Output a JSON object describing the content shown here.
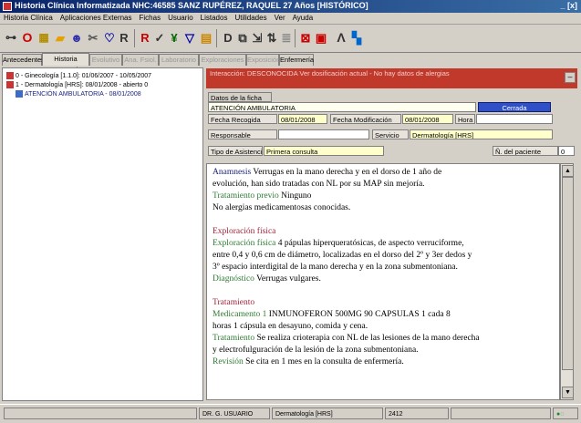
{
  "window": {
    "title": "Historia Clínica Informatizada  NHC:46585   SANZ RUPÉREZ, RAQUEL   27 Años [HISTÓRICO]",
    "controls": "_ [x]"
  },
  "menu": [
    "Historia Clínica",
    "Aplicaciones Externas",
    "Fichas",
    "Usuario",
    "Listados",
    "Utilidades",
    "Ver",
    "Ayuda"
  ],
  "toolbar_icons": [
    "pin-icon",
    "exit-icon",
    "gallery-icon",
    "folder-icon",
    "user-icon",
    "scissors-icon",
    "heart-icon",
    "report-icon",
    "form-icon",
    "check-icon",
    "chart-icon",
    "filter-icon",
    "print-icon",
    "doc-icon",
    "copy-icon",
    "export-icon",
    "sort-icon",
    "list-icon",
    "cancel-icon",
    "save-icon",
    "help-icon",
    "tree-icon"
  ],
  "tabs": [
    "Antecedentes",
    "Historia General",
    "Evolutivo",
    "Ana. Fsiol.",
    "Laboratorio",
    "Exploraciones",
    "Exposición",
    "Enfermería"
  ],
  "tree": [
    "0 - Ginecología [1.1.0]: 01/06/2007 - 10/05/2007",
    "1 - Dermatología [HRS]: 08/01/2008 - abierto 0",
    "ATENCIÓN AMBULATORIA - 08/01/2008"
  ],
  "banner": "Interacción: DESCONOCIDA  Ver dosificación actual - No hay datos de alergias",
  "form": {
    "tab_label": "Datos de la ficha",
    "title_value": "ATENCIÓN AMBULATORIA",
    "status_button": "Cerrada",
    "fecha_label": "Fecha Recogida",
    "fecha_value": "08/01/2008",
    "fmod_label": "Fecha Modificación",
    "fmod_value": "08/01/2008",
    "hora_label": "Hora",
    "resp_label": "Responsable",
    "servicio_label": "Servicio",
    "servicio_value": "Dermatología [HRS]",
    "tipo_label": "Tipo de Asistencia",
    "tipo_value": "Primera consulta",
    "pend_label": "Ñ. del paciente",
    "pend_value": "0"
  },
  "notes": [
    {
      "label": "Anamnesis",
      "text": " Verrugas en la mano derecha y en el dorso de 1 año de"
    },
    {
      "label": "",
      "text": "evolución, han sido tratadas con NL por su MAP sin mejoría."
    },
    {
      "label": "Tratamiento previo",
      "text": "  Ninguno"
    },
    {
      "label": "",
      "text": "No alergias medicamentosas conocidas."
    },
    {
      "label": "",
      "text": ""
    },
    {
      "label": "Exploración física",
      "text": ""
    },
    {
      "label": "Exploración física",
      "text": " 4 pápulas hiperqueratósicas, de aspecto verruciforme,"
    },
    {
      "label": "",
      "text": "entre 0,4 y 0,6 cm de diámetro, localizadas en el dorso del 2º y 3er dedos y"
    },
    {
      "label": "",
      "text": "3º espacio interdigital de la mano derecha y en la zona submentoniana."
    },
    {
      "label": "Diagnóstico",
      "text": "  Verrugas vulgares."
    },
    {
      "label": "",
      "text": ""
    },
    {
      "label": "Tratamiento",
      "text": ""
    },
    {
      "label": "Medicamento 1",
      "text": " INMUNOFERON 500MG 90 CAPSULAS 1 cada 8"
    },
    {
      "label": "",
      "text": "horas 1 cápsula en desayuno, comida y cena."
    },
    {
      "label": "Tratamiento",
      "text": "  Se realiza crioterapia con NL de las lesiones de la mano derecha"
    },
    {
      "label": "",
      "text": "y electrofulguración de la lesión de la zona submentoniana."
    },
    {
      "label": "Revisión",
      "text": "  Se cita en 1 mes en la consulta de enfermería."
    }
  ],
  "status": {
    "user": "DR. G. USUARIO",
    "service": "Dermatología [HRS]",
    "code": "2412"
  },
  "colors": {
    "label": "#2e7d32",
    "heading": "#a0243c",
    "link": "#1a237e"
  }
}
